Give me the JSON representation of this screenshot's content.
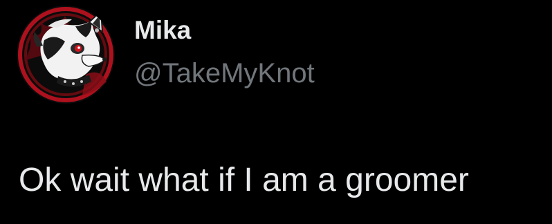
{
  "tweet": {
    "display_name": "Mika",
    "handle": "@TakeMyKnot",
    "text": "Ok wait what if I am a groomer"
  },
  "colors": {
    "background": "#000000",
    "text_primary": "#e7e9ea",
    "text_secondary": "#71767b",
    "avatar_accent": "#c0121f"
  },
  "icons": {
    "avatar": "profile-avatar-illustration"
  }
}
